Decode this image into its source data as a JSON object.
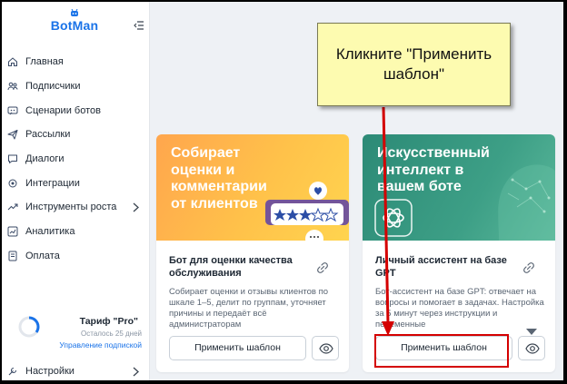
{
  "app": {
    "logo": "BotMan"
  },
  "sidebar": {
    "items": [
      {
        "label": "Главная",
        "icon": "home-icon"
      },
      {
        "label": "Подписчики",
        "icon": "users-icon"
      },
      {
        "label": "Сценарии ботов",
        "icon": "scenario-icon"
      },
      {
        "label": "Рассылки",
        "icon": "send-icon"
      },
      {
        "label": "Диалоги",
        "icon": "chat-icon"
      },
      {
        "label": "Интеграции",
        "icon": "integrations-icon"
      },
      {
        "label": "Инструменты роста",
        "icon": "growth-icon",
        "has_submenu": true
      },
      {
        "label": "Аналитика",
        "icon": "analytics-icon"
      },
      {
        "label": "Оплата",
        "icon": "payment-icon"
      }
    ],
    "plan": {
      "name": "Тариф \"Pro\"",
      "days_left": "Осталось 25 дней",
      "manage_label": "Управление подпиской",
      "ring_progress": 0.35
    },
    "settings": {
      "label": "Настройки",
      "icon": "settings-icon"
    }
  },
  "cards": [
    {
      "banner_text": [
        "Собирает",
        "оценки и",
        "комментарии",
        "от клиентов"
      ],
      "title": "Бот для оценки качества обслуживания",
      "description": "Собирает оценки и отзывы клиентов по шкале 1–5, делит по группам, уточняет причины и передаёт всё администраторам",
      "apply_label": "Применить шаблон",
      "banner_color": "#ffb347"
    },
    {
      "banner_text": [
        "Искусственный",
        "интеллект в",
        "вашем боте"
      ],
      "title": "Личный ассистент на базе GPT",
      "description": "Бот-ассистент на базе GPT: отвечает на вопросы и помогает в задачах. Настройка за 5 минут через инструкции и переменные",
      "apply_label": "Применить шаблон",
      "banner_color": "#3a9a82"
    }
  ],
  "callout": {
    "text": "Кликните \"Применить шаблон\""
  },
  "colors": {
    "accent": "#1a73e8",
    "highlight": "#d40000",
    "callout_bg": "#fdfbb0"
  }
}
